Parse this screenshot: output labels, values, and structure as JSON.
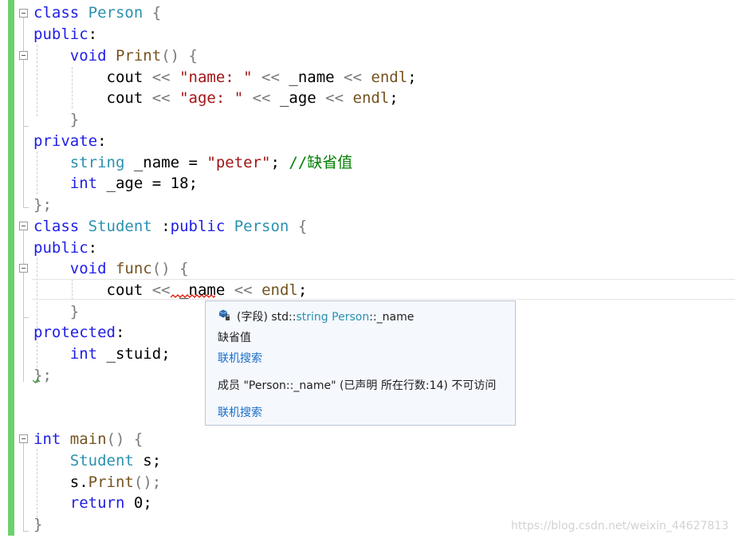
{
  "code": {
    "l1": {
      "kw": "class",
      "name": "Person",
      "brace": "{"
    },
    "l2": {
      "kw": "public",
      "colon": ":"
    },
    "l3": {
      "type": "void",
      "fn": "Print",
      "rest": "() {"
    },
    "l4": {
      "id": "cout",
      "op1": "<<",
      "str": "\"name: \"",
      "op2": "<<",
      "var": "_name",
      "op3": "<<",
      "endl": "endl",
      "semi": ";"
    },
    "l5": {
      "id": "cout",
      "op1": "<<",
      "str": "\"age: \"",
      "op2": "<<",
      "var": "_age",
      "op3": "<<",
      "endl": "endl",
      "semi": ";"
    },
    "l6": {
      "brace": "}"
    },
    "l7": {
      "kw": "private",
      "colon": ":"
    },
    "l8": {
      "type": "string",
      "var": "_name",
      "eq": "=",
      "str": "\"peter\"",
      "semi": ";",
      "comment": "//缺省值"
    },
    "l9": {
      "type": "int",
      "var": "_age",
      "eq": "=",
      "num": "18",
      "semi": ";"
    },
    "l10": {
      "brace": "};"
    },
    "l11": {
      "kw": "class",
      "name": "Student",
      "colon": ":",
      "kw2": "public",
      "base": "Person",
      "brace": "{"
    },
    "l12": {
      "kw": "public",
      "colon": ":"
    },
    "l13": {
      "type": "void",
      "fn": "func",
      "rest": "() {"
    },
    "l14": {
      "id": "cout",
      "op1": "<<",
      "var": "_name",
      "op2": "<<",
      "endl": "endl",
      "semi": ";"
    },
    "l15": {
      "brace": "}"
    },
    "l16": {
      "kw": "protected",
      "colon": ":"
    },
    "l17": {
      "type": "int",
      "var": "_stuid",
      "semi": ";"
    },
    "l18": {
      "brace": "};"
    },
    "l19": {
      "type": "int",
      "fn": "main",
      "rest": "() {"
    },
    "l20": {
      "type": "Student",
      "var": "s",
      "semi": ";"
    },
    "l21": {
      "obj": "s",
      "dot": ".",
      "fn": "Print",
      "rest": "();"
    },
    "l22": {
      "kw": "return",
      "num": "0",
      "semi": ";"
    },
    "l23": {
      "brace": "}"
    }
  },
  "tooltip": {
    "sig_prefix": "(字段) std::",
    "sig_type": "string",
    "sig_space": " ",
    "sig_class": "Person",
    "sig_member": "::_name",
    "doc": "缺省值",
    "search1": "联机搜索",
    "error": "成员 \"Person::_name\" (已声明 所在行数:14) 不可访问",
    "search2": "联机搜索"
  },
  "watermark": "https://blog.csdn.net/weixin_44627813",
  "colors": {
    "gutter": "#6cd16c",
    "keyword": "#1e1ee6",
    "type": "#2b91af",
    "string": "#a31515",
    "comment": "#008000",
    "error_squiggle": "#e51400",
    "link": "#1a6fc8"
  }
}
